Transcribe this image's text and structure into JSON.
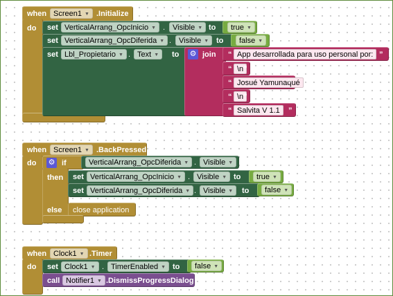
{
  "keywords": {
    "when": "when",
    "do": "do",
    "set": "set",
    "to": "to",
    "join": "join",
    "if": "if",
    "then": "then",
    "else": "else",
    "call": "call",
    "dot": ".",
    "quote": "“",
    "quote_close": "”"
  },
  "colors": {
    "event_block": "#b18e35",
    "component_block": "#326443",
    "logic_block": "#77ab41",
    "text_block": "#b32d5e",
    "method_block": "#7a4e8f",
    "mutator_icon": "#5b58d6"
  },
  "icons": {
    "mutator": "gear-icon",
    "dropdown": "dropdown-arrow-icon"
  },
  "event_initialize": {
    "component": "Screen1",
    "event": ".Initialize",
    "statements": [
      {
        "component": "VerticalArrang_OpcInicio",
        "property": "Visible",
        "value": "true"
      },
      {
        "component": "VerticalArrang_OpcDiferida",
        "property": "Visible",
        "value": "false"
      }
    ],
    "join_set": {
      "component": "Lbl_Propietario",
      "property": "Text",
      "texts": [
        "App desarrollada para uso personal por:",
        "\\n",
        "Josué Yamunaqué",
        "\\n",
        "Salvita  V 1.1"
      ]
    }
  },
  "event_backpressed": {
    "component": "Screen1",
    "event": ".BackPressed",
    "condition": {
      "component": "VerticalArrang_OpcDiferida",
      "property": "Visible"
    },
    "then_statements": [
      {
        "component": "VerticalArrang_OpcInicio",
        "property": "Visible",
        "value": "true"
      },
      {
        "component": "VerticalArrang_OpcDiferida",
        "property": "Visible",
        "value": "false"
      }
    ],
    "else_statement": "close application"
  },
  "event_timer": {
    "component": "Clock1",
    "event": ".Timer",
    "set_statement": {
      "component": "Clock1",
      "property": "TimerEnabled",
      "value": "false"
    },
    "call_statement": {
      "component": "Notifier1",
      "method": ".DismissProgressDialog"
    }
  }
}
